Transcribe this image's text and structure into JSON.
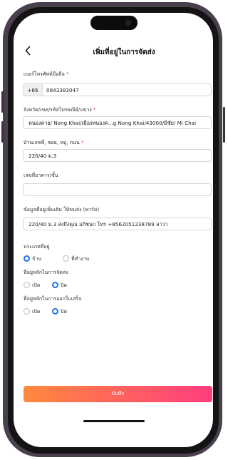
{
  "header": {
    "title": "เพิ่มที่อยู่ในการจัดส่ง"
  },
  "form": {
    "phone": {
      "label": "เบอร์โทรศัพท์มือถือ",
      "required": "*",
      "country_code": "+66",
      "value": "0843383047"
    },
    "province": {
      "label": "จังหวัด/เขต/รหัสไปรษณีย์/แขวง",
      "required": "*",
      "value": "หนองคาย/ Nong Khai/เมืองหนองค...g Nong Khai/43000/มีชัย/ Mi Chai"
    },
    "house": {
      "label": "บ้านเลขที่, ซอย, หมู่, ถนน",
      "required": "*",
      "value": "220/40 ม.3"
    },
    "building": {
      "label": "เลขที่อาคาร/ชั้น",
      "value": ""
    },
    "extra": {
      "label": "ข้อมูลที่อยู่เพิ่มเติม ให้ขนส่ง (พาร์ม)",
      "value": "220/40 ม.3 ส่งถึงคุณ อภิชนก โทร +8562051238789 ลาวา"
    },
    "address_type": {
      "label": "ประเภทที่อยู่",
      "options": [
        {
          "label": "บ้าน",
          "selected": true
        },
        {
          "label": "ที่ทำงาน",
          "selected": false
        }
      ]
    },
    "default_shipping": {
      "label": "ที่อยู่หลักในการจัดส่ง",
      "options": [
        {
          "label": "เปิด",
          "selected": false
        },
        {
          "label": "ปิด",
          "selected": true
        }
      ]
    },
    "default_billing": {
      "label": "ที่อยู่หลักในการออกใบเสร็จ",
      "options": [
        {
          "label": "เปิด",
          "selected": false
        },
        {
          "label": "ปิด",
          "selected": true
        }
      ]
    },
    "save_label": "บันทึก"
  },
  "colors": {
    "accent": "#1a73e8",
    "button_start": "#ff8a3d",
    "button_end": "#ff3d7f",
    "required": "#e53935"
  },
  "icons": {
    "back": "chevron-left-icon"
  }
}
